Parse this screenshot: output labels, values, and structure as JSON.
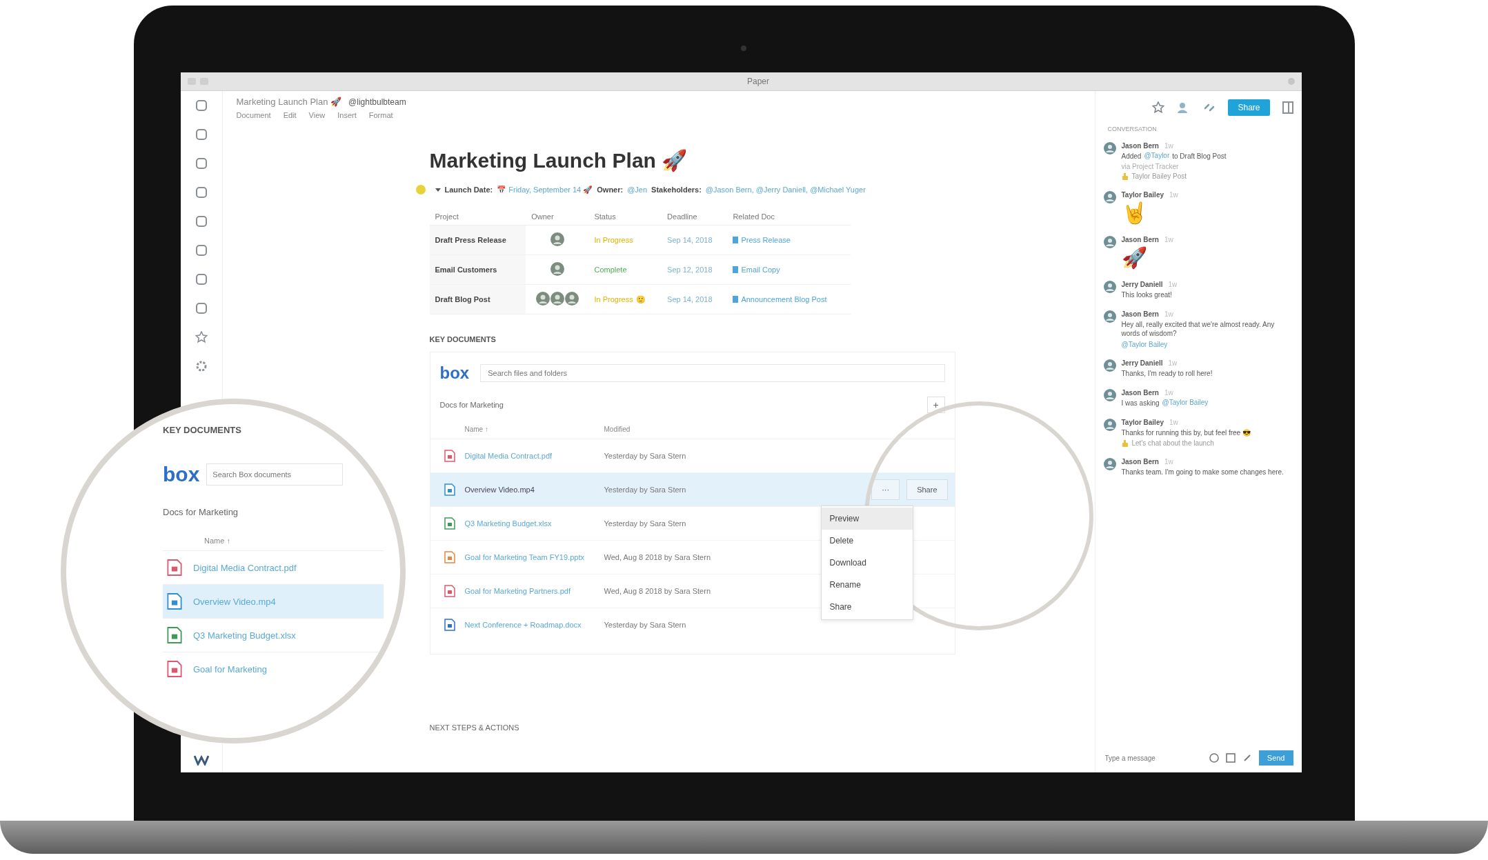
{
  "window": {
    "title": "Paper"
  },
  "doc_header": {
    "path": "Marketing Launch Plan 🚀",
    "mention": "@lightbulbteam",
    "menu": [
      "Document",
      "Edit",
      "View",
      "Insert",
      "Format"
    ]
  },
  "toolbar": {
    "share_button": "Share"
  },
  "page": {
    "title": "Marketing Launch Plan 🚀",
    "meta": [
      {
        "label": "Launch Date:",
        "value": "📅 Friday, September 14 🚀"
      },
      {
        "label": "Owner:",
        "value": "@Jen"
      },
      {
        "label": "Stakeholders:",
        "value": "@Jason Bern, @Jerry Daniell, @Michael Yuger"
      }
    ],
    "projects": {
      "columns": [
        "Project",
        "Owner",
        "Status",
        "Deadline",
        "Related Doc"
      ],
      "rows": [
        {
          "project": "Draft Press Release",
          "kind": "single",
          "status": "In Progress",
          "color": "#e2b100",
          "deadline": "Sep 14, 2018",
          "doc": "Press Release"
        },
        {
          "project": "Email Customers",
          "kind": "single",
          "status": "Complete",
          "color": "#4caf50",
          "deadline": "Sep 12, 2018",
          "doc": "Email Copy"
        },
        {
          "project": "Draft Blog Post",
          "kind": "group",
          "status": "In Progress",
          "emoji": "🙂",
          "color": "#e2b100",
          "deadline": "Sep 14, 2018",
          "doc": "Announcement Blog Post"
        }
      ]
    },
    "key_documents": {
      "heading": "KEY DOCUMENTS",
      "logo": "box",
      "search": {
        "placeholder": "Search files and folders"
      },
      "folder": "Docs for Marketing",
      "add": "+",
      "columns": [
        "Name ↑",
        "Modified"
      ],
      "files": [
        {
          "name": "Digital Media Contract.pdf",
          "modified": "Yesterday by Sara Stern",
          "kind": "pdf",
          "selected": false
        },
        {
          "name": "Overview Video.mp4",
          "modified": "Yesterday by Sara Stern",
          "kind": "video",
          "selected": true
        },
        {
          "name": "Q3 Marketing Budget.xlsx",
          "modified": "Yesterday by Sara Stern",
          "kind": "sheet",
          "selected": false
        },
        {
          "name": "Goal for Marketing Team FY19.pptx",
          "modified": "Wed, Aug 8 2018 by Sara Stern",
          "kind": "slides",
          "selected": false
        },
        {
          "name": "Goal for Marketing Partners.pdf",
          "modified": "Wed, Aug 8 2018 by Sara Stern",
          "kind": "pdf",
          "selected": false
        },
        {
          "name": "Next Conference + Roadmap.docx",
          "modified": "Yesterday by Sara Stern",
          "kind": "doc",
          "selected": false
        }
      ],
      "row_actions": {
        "more": "···",
        "share": "Share"
      },
      "menu": [
        {
          "label": "Preview",
          "selected": true
        },
        {
          "label": "Delete",
          "selected": false
        },
        {
          "label": "Download",
          "selected": false
        },
        {
          "label": "Rename",
          "selected": false
        },
        {
          "label": "Share",
          "selected": false
        }
      ]
    },
    "next_heading": "NEXT STEPS & ACTIONS"
  },
  "magnifier": {
    "heading": "KEY DOCUMENTS",
    "logo": "box",
    "placeholder": "Search Box documents",
    "folder": "Docs for Marketing",
    "column": "Name ↑",
    "files": [
      {
        "name": "Digital Media Contract.pdf",
        "kind": "pdf",
        "selected": false
      },
      {
        "name": "Overview Video.mp4",
        "kind": "video",
        "selected": true
      },
      {
        "name": "Q3 Marketing Budget.xlsx",
        "kind": "sheet",
        "selected": false
      },
      {
        "name": "Goal for Marketing",
        "kind": "pdf",
        "selected": false
      }
    ]
  },
  "comments": {
    "heading": "CONVERSATION",
    "items": [
      {
        "author": "Jason Bern",
        "time": "1w",
        "text": "Added",
        "link": "@Taylor",
        "rest": "to Draft Blog Post",
        "note": "via Project Tracker",
        "attachment": "Taylor Bailey Post",
        "kind": "text"
      },
      {
        "author": "Taylor Bailey",
        "time": "1w",
        "text": "🤘",
        "kind": "emoji"
      },
      {
        "author": "Jason Bern",
        "time": "1w",
        "text": "🚀",
        "kind": "emoji"
      },
      {
        "author": "Jerry Daniell",
        "time": "1w",
        "text": "This looks great!",
        "kind": "text"
      },
      {
        "author": "Jason Bern",
        "time": "1w",
        "text": "Hey all, really excited that we're almost ready. Any words of wisdom?",
        "link": "@Taylor Bailey",
        "kind": "text"
      },
      {
        "author": "Jerry Daniell",
        "time": "1w",
        "text": "Thanks, I'm ready to roll here!",
        "kind": "text"
      },
      {
        "author": "Jason Bern",
        "time": "1w",
        "text": "I was asking",
        "link": "@Taylor Bailey",
        "kind": "text"
      },
      {
        "author": "Taylor Bailey",
        "time": "1w",
        "text": "Thanks for running this by, but feel free 😎",
        "attachment": "Let's chat about the launch",
        "kind": "text"
      },
      {
        "author": "Jason Bern",
        "time": "1w",
        "text": "Thanks team. I'm going to make some changes here.",
        "kind": "text"
      }
    ],
    "composer": {
      "placeholder": "Type a message",
      "send": "Send"
    }
  }
}
